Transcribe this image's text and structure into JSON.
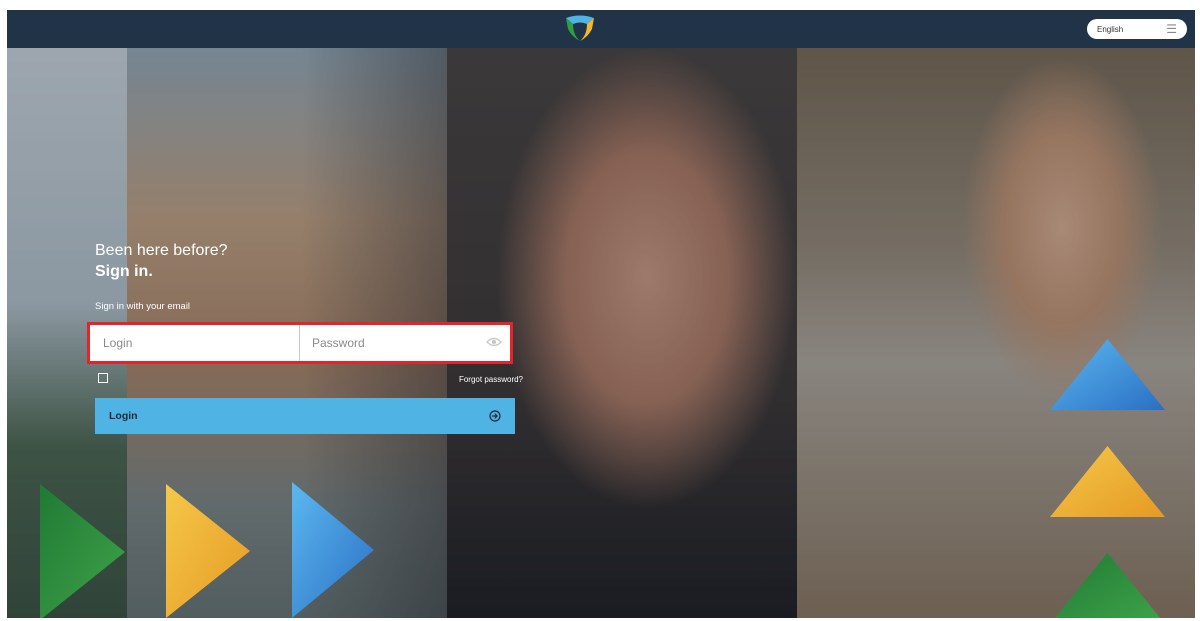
{
  "header": {
    "language_selected": "English",
    "icons": {
      "logo": "brand-shield-logo-icon",
      "language_menu": "hamburger-menu-icon"
    }
  },
  "signin": {
    "heading_line1": "Been here before?",
    "heading_line2": "Sign in.",
    "subtitle": "Sign in with your email",
    "login_placeholder": "Login",
    "password_placeholder": "Password",
    "forgot_password": "Forgot password?",
    "login_button": "Login",
    "icons": {
      "password_toggle": "eye-icon",
      "submit": "arrow-circle-right-icon"
    }
  },
  "colors": {
    "header_bg": "#213347",
    "button_bg": "#4fb3e3",
    "highlight_border": "#e3242b",
    "tri_green": "#2e8b3c",
    "tri_yellow": "#f2b632",
    "tri_blue": "#3a8fd8"
  }
}
